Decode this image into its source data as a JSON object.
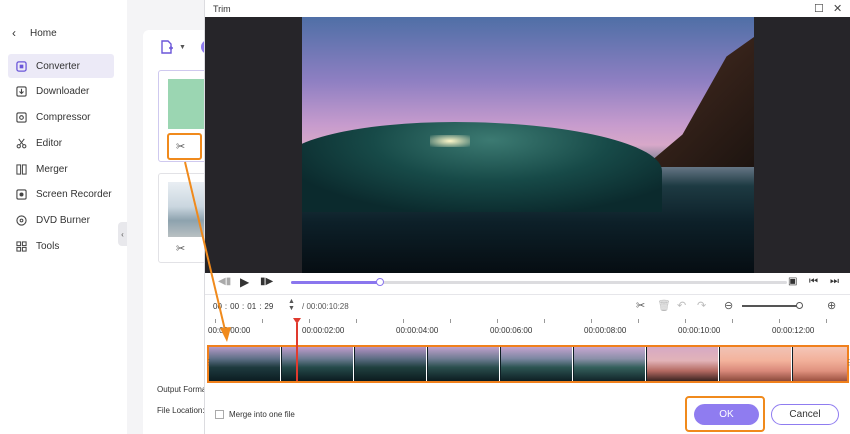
{
  "sidebar": {
    "home_label": "Home",
    "items": [
      {
        "label": "Converter",
        "icon": "converter-icon",
        "active": true
      },
      {
        "label": "Downloader",
        "icon": "downloader-icon"
      },
      {
        "label": "Compressor",
        "icon": "compressor-icon"
      },
      {
        "label": "Editor",
        "icon": "editor-icon"
      },
      {
        "label": "Merger",
        "icon": "merger-icon"
      },
      {
        "label": "Screen Recorder",
        "icon": "screen-recorder-icon"
      },
      {
        "label": "DVD Burner",
        "icon": "dvd-burner-icon"
      },
      {
        "label": "Tools",
        "icon": "tools-icon"
      }
    ]
  },
  "main": {
    "output_format_label": "Output Forma",
    "file_location_label": "File Location:"
  },
  "dialog": {
    "title": "Trim",
    "current_time": {
      "hh": "00",
      "mm": "00",
      "ss": "01",
      "ff": "29"
    },
    "duration": "/ 00:00:10:28",
    "progress_fraction": 0.18,
    "zoom_fraction": 0.95,
    "ruler": [
      "00:00:00:00",
      "00:00:02:00",
      "00:00:04:00",
      "00:00:06:00",
      "00:00:08:00",
      "00:00:10:00",
      "00:00:12:00"
    ],
    "merge_label": "Merge into one file",
    "ok_label": "OK",
    "cancel_label": "Cancel"
  },
  "colors": {
    "accent": "#8f7cf0",
    "highlight": "#f08a1c",
    "playhead": "#e03a2e"
  }
}
